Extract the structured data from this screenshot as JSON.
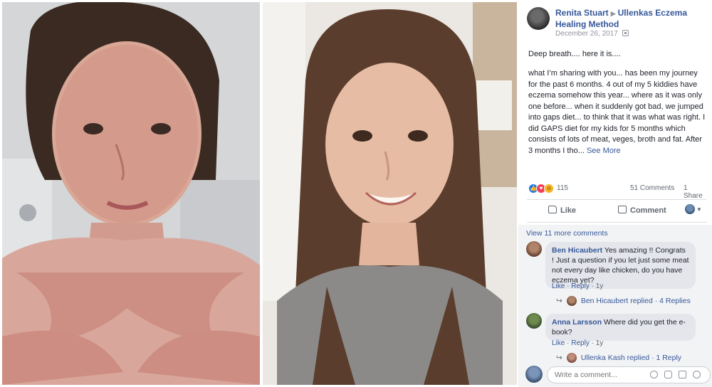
{
  "post": {
    "author": "Renita Stuart",
    "group": "Ullenkas Eczema Healing Method",
    "date": "December 26, 2017",
    "intro": "Deep breath.... here it is....",
    "body": "what I’m sharing with you... has been my journey for the past 6 months. 4 out of my 5 kiddies have eczema somehow this year... where as it was only one before... when it suddenly got bad, we jumped into gaps diet... to think that it was what was right. I did GAPS diet for my kids for 5 months which consists of lots of meat, veges, broth and fat. After 3 months I tho...",
    "see_more": "See More"
  },
  "stats": {
    "reaction_count": "115",
    "comments": "51 Comments",
    "shares": "1 Share"
  },
  "actions": {
    "like": "Like",
    "comment": "Comment"
  },
  "comments": {
    "view_more": "View 11 more comments",
    "items": [
      {
        "author": "Ben Hicaubert",
        "text": "Yes amazing !! Congrats ! Just a question if you let just some meat not every day like chicken, do you have eczema yet?",
        "like": "Like",
        "reply": "Reply",
        "age": "1y",
        "replies_summary": "Ben Hicaubert replied · 4 Replies"
      },
      {
        "author": "Anna Larsson",
        "text": "Where did you get the e-book?",
        "like": "Like",
        "reply": "Reply",
        "age": "1y",
        "replies_summary": "Ullenka Kash replied · 1 Reply"
      }
    ]
  },
  "composer": {
    "placeholder": "Write a comment..."
  },
  "icons": [
    "like-reaction-icon",
    "love-reaction-icon",
    "wow-reaction-icon",
    "globe-icon",
    "like-icon",
    "comment-icon",
    "emoji-icon",
    "camera-icon",
    "gif-icon",
    "sticker-icon"
  ],
  "colors": {
    "link_blue": "#365899",
    "bubble_gray": "#e4e6eb",
    "meta_gray": "#606770",
    "like_blue": "#1877f2",
    "love_red": "#f33e58"
  }
}
